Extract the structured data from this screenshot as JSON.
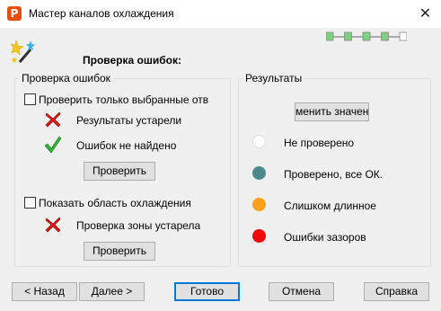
{
  "window": {
    "title": "Мастер каналов охлаждения",
    "app_icon_glyph": "P",
    "close_glyph": "✕"
  },
  "header": {
    "title": "Проверка ошибок:",
    "wizard_icon": "wizard-wand-icon",
    "progress": {
      "total_steps": 5,
      "completed_steps": 4
    }
  },
  "error_check": {
    "group_label": "Проверка ошибок",
    "only_selected_label": "Проверить только выбранные отв",
    "only_selected_checked": false,
    "status_outdated": {
      "icon": "red-x-icon",
      "text": "Результаты устарели"
    },
    "status_ok": {
      "icon": "green-check-icon",
      "text": "Ошибок не найдено"
    },
    "check_button_label": "Проверить",
    "show_area_label": "Показать область охлаждения",
    "show_area_checked": false,
    "zone_status": {
      "icon": "red-x-icon",
      "text": "Проверка зоны устарела"
    },
    "check_zone_button_label": "Проверить"
  },
  "results": {
    "group_label": "Результаты",
    "change_button_label": "менить значен",
    "legend": [
      {
        "color": "#ffffff",
        "label": "Не проверено"
      },
      {
        "color": "#4a8a8a",
        "label": "Проверено, все ОК."
      },
      {
        "color": "#ffa01e",
        "label": "Слишком длинное"
      },
      {
        "color": "#ff0000",
        "label": "Ошибки зазоров"
      }
    ]
  },
  "footer": {
    "back_label": "< Назад",
    "next_label": "Далее >",
    "done_label": "Готово",
    "cancel_label": "Отмена",
    "help_label": "Справка"
  },
  "colors": {
    "progress_done": "#7fd17f",
    "progress_pending": "#ffffff",
    "default_button_border": "#0078d7"
  }
}
